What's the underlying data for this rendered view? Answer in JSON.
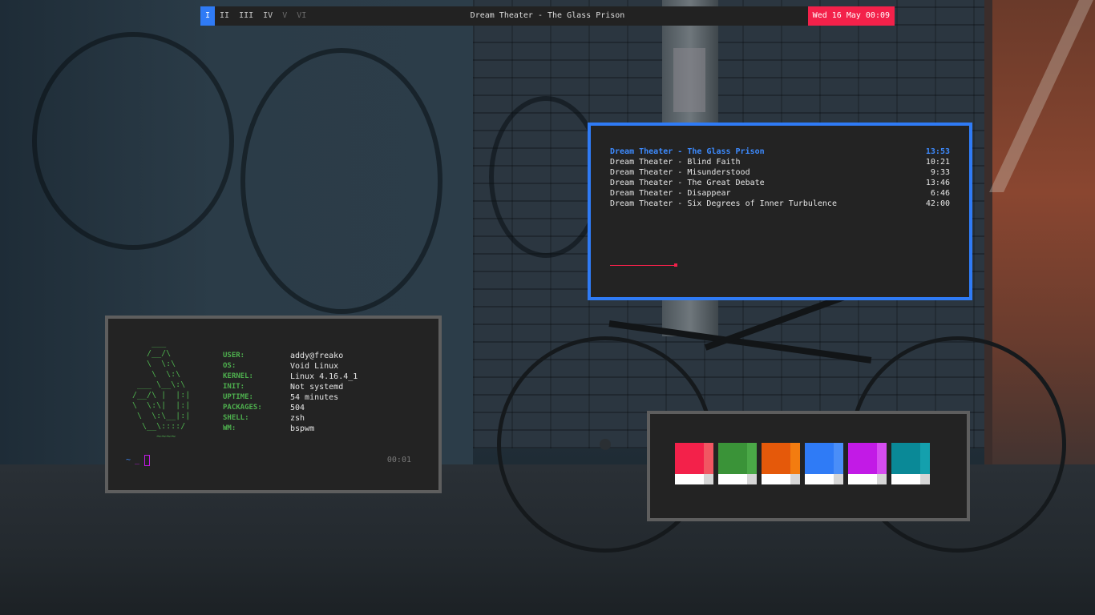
{
  "topbar": {
    "workspaces": [
      {
        "label": "I",
        "state": "active"
      },
      {
        "label": "II",
        "state": "occupied"
      },
      {
        "label": "III",
        "state": "occupied"
      },
      {
        "label": "IV",
        "state": "occupied"
      },
      {
        "label": "V",
        "state": "empty"
      },
      {
        "label": "VI",
        "state": "empty"
      }
    ],
    "now_playing": "Dream Theater - The Glass Prison",
    "clock": "Wed 16 May 00:09"
  },
  "music": {
    "playlist": [
      {
        "title": "Dream Theater - The Glass Prison",
        "duration": "13:53",
        "playing": true
      },
      {
        "title": "Dream Theater - Blind Faith",
        "duration": "10:21",
        "playing": false
      },
      {
        "title": "Dream Theater - Misunderstood",
        "duration": "9:33",
        "playing": false
      },
      {
        "title": "Dream Theater - The Great Debate",
        "duration": "13:46",
        "playing": false
      },
      {
        "title": "Dream Theater - Disappear",
        "duration": "6:46",
        "playing": false
      },
      {
        "title": "Dream Theater - Six Degrees of Inner Turbulence",
        "duration": "42:00",
        "playing": false
      }
    ],
    "progress_fraction": 0.19
  },
  "fetch": {
    "ascii_logo": "    ___\n   /__/\\\n   \\  \\:\\\n    \\  \\:\\\n ___ \\__\\:\\\n/__/\\ |  |:|\n\\  \\:\\|  |:|\n \\  \\:\\__|:|\n  \\__\\::::/\n     ~~~~",
    "info": [
      {
        "key": "USER:",
        "value": "addy@freako"
      },
      {
        "key": "OS:",
        "value": "Void Linux"
      },
      {
        "key": "KERNEL:",
        "value": "Linux 4.16.4_1"
      },
      {
        "key": "INIT:",
        "value": "Not systemd"
      },
      {
        "key": "UPTIME:",
        "value": "54 minutes"
      },
      {
        "key": "PACKAGES:",
        "value": "504"
      },
      {
        "key": "SHELL:",
        "value": "zsh"
      },
      {
        "key": "WM:",
        "value": "bspwm"
      }
    ],
    "prompt_tilde": "~",
    "prompt_arrow": "_",
    "timer": "00:01"
  },
  "colors": {
    "swatches": [
      {
        "name": "red",
        "main": "#f3214a",
        "bright": "#f15662"
      },
      {
        "name": "green",
        "main": "#3a9338",
        "bright": "#4aa847"
      },
      {
        "name": "orange",
        "main": "#e5590a",
        "bright": "#f37c10"
      },
      {
        "name": "blue",
        "main": "#2f7bf6",
        "bright": "#4a8ef8"
      },
      {
        "name": "magenta",
        "main": "#c21ae6",
        "bright": "#d64cf0"
      },
      {
        "name": "cyan",
        "main": "#0a8997",
        "bright": "#14a0ad"
      }
    ]
  },
  "theme": {
    "accent": "#2f7bf6",
    "alert": "#f3214a",
    "panel_bg": "#232323",
    "bar_bg": "#222222",
    "fetch_green": "#4eb04e"
  }
}
